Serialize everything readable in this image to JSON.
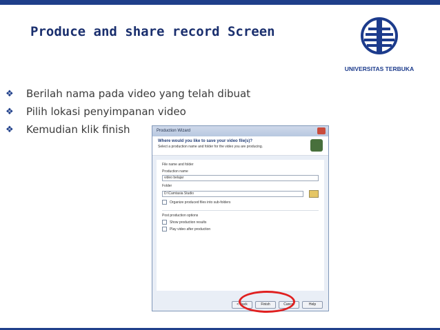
{
  "slide": {
    "title": "Produce and share record Screen",
    "logo_text": "UNIVERSITAS TERBUKA",
    "bullets": [
      "Berilah nama pada video yang telah dibuat",
      "Pilih lokasi penyimpanan video",
      "Kemudian klik finish"
    ]
  },
  "dialog": {
    "title": "Production Wizard",
    "question": "Where would you like to save your video file(s)?",
    "subtitle": "Select a production name and folder for the video you are producing.",
    "section_file": "File name and folder",
    "production_name_label": "Production name",
    "production_name_value": "video belajar",
    "folder_label": "Folder",
    "folder_value": "D:\\Camtasia Studio",
    "organize_label": "Organize produced files into sub-folders",
    "post_options": "Post production options",
    "show_results_label": "Show production results",
    "play_video_label": "Play video after production",
    "buttons": {
      "back": "< Back",
      "finish": "Finish",
      "cancel": "Cancel",
      "help": "Help"
    }
  },
  "colors": {
    "accent": "#1f3f8a",
    "highlight": "#e02020"
  }
}
